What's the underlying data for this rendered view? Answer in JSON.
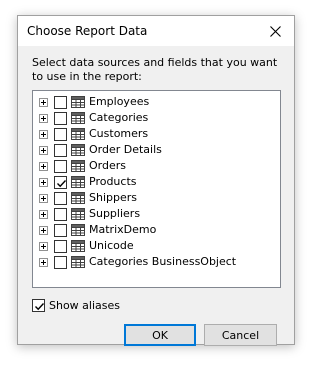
{
  "dialog": {
    "title": "Choose Report Data",
    "instructions": "Select data sources and fields that you want to use in the report:"
  },
  "tree": {
    "items": [
      {
        "label": "Employees",
        "checked": false
      },
      {
        "label": "Categories",
        "checked": false
      },
      {
        "label": "Customers",
        "checked": false
      },
      {
        "label": "Order Details",
        "checked": false
      },
      {
        "label": "Orders",
        "checked": false
      },
      {
        "label": "Products",
        "checked": true
      },
      {
        "label": "Shippers",
        "checked": false
      },
      {
        "label": "Suppliers",
        "checked": false
      },
      {
        "label": "MatrixDemo",
        "checked": false
      },
      {
        "label": "Unicode",
        "checked": false
      },
      {
        "label": "Categories BusinessObject",
        "checked": false
      }
    ]
  },
  "options": {
    "show_aliases_label": "Show aliases",
    "show_aliases_checked": true
  },
  "buttons": {
    "ok_label": "OK",
    "cancel_label": "Cancel"
  },
  "icons": {
    "close": "close-icon",
    "expander": "plus-expander-icon",
    "table": "table-icon",
    "check": "checkmark-icon"
  }
}
